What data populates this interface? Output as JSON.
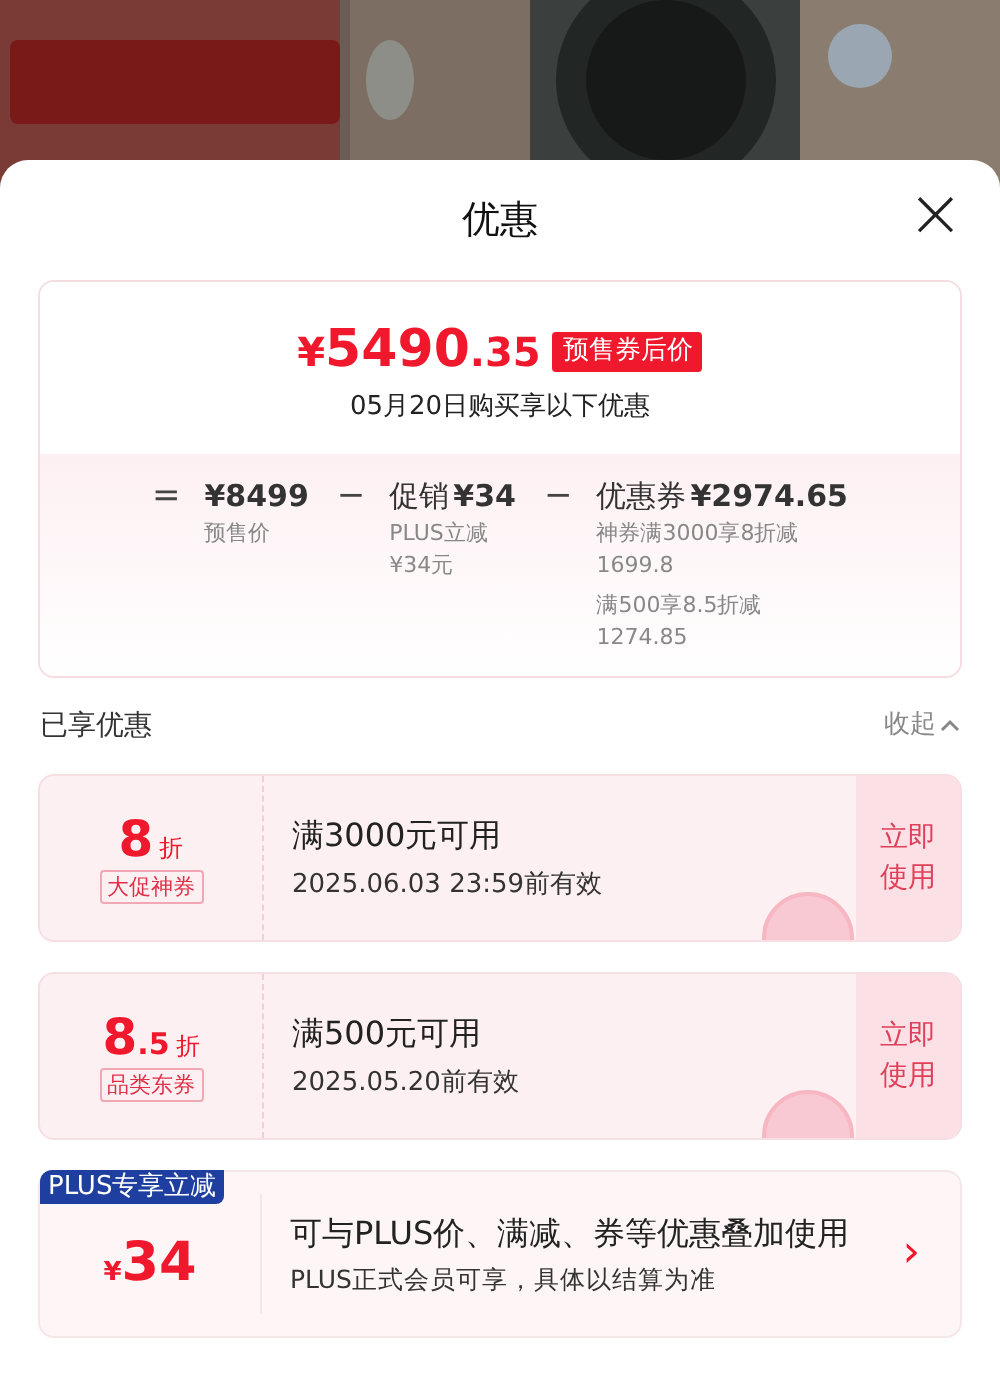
{
  "sheet": {
    "title": "优惠",
    "close": "×"
  },
  "summary": {
    "final_price": {
      "currency": "¥",
      "integer": "5490",
      "decimal": ".35"
    },
    "badge": "预售券后价",
    "subtitle": "05月20日购买享以下优惠",
    "breakdown": [
      {
        "op": "=",
        "amount": "¥8499",
        "notes": [
          "预售价"
        ]
      },
      {
        "op": "−",
        "label": "促销",
        "amount": "¥34",
        "notes": [
          "PLUS立减",
          "¥34元"
        ]
      },
      {
        "op": "−",
        "label": "优惠券",
        "amount": "¥2974.65",
        "notes": [
          "神券满3000享8折减",
          "1699.8",
          "满500享8.5折减",
          "1274.85"
        ]
      }
    ]
  },
  "section": {
    "title": "已享优惠",
    "toggle": "收起",
    "expanded": true
  },
  "coupons": [
    {
      "kind": "coupon",
      "value": "8",
      "unit": "折",
      "tag": "大促神券",
      "condition": "满3000元可用",
      "validity": "2025.06.03 23:59前有效",
      "action": "立即使用",
      "claimed": true
    },
    {
      "kind": "coupon",
      "value": "8",
      "value_small": ".5",
      "unit": "折",
      "tag": "品类东券",
      "condition": "满500元可用",
      "validity": "2025.05.20前有效",
      "action": "立即使用",
      "claimed": true
    },
    {
      "kind": "plus",
      "badge": "PLUS专享立减",
      "currency": "¥",
      "value": "34",
      "condition": "可与PLUS价、满减、券等优惠叠加使用",
      "validity": "PLUS正式会员可享，具体以结算为准",
      "arrow": "›"
    }
  ]
}
